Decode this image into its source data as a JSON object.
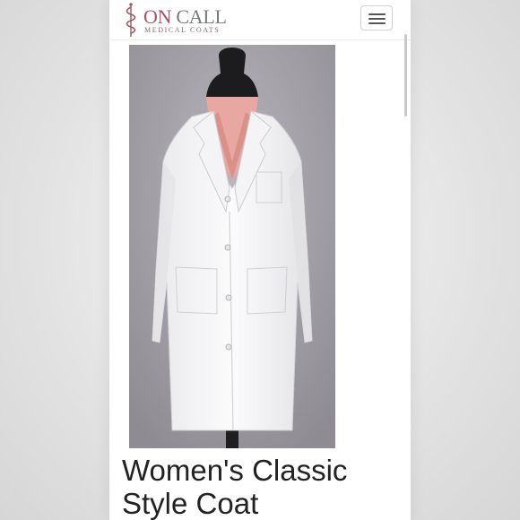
{
  "header": {
    "brand_on": "ON",
    "brand_call": "CALL",
    "tagline": "MEDICAL COATS",
    "menu_icon": "hamburger-icon"
  },
  "product": {
    "image": "white lab coat on mannequin",
    "title_line1": "Women's Classic",
    "title_line2": "Style Coat"
  },
  "colors": {
    "brand_accent": "#a8545e",
    "brand_gray": "#7a7a7a",
    "title_text": "#222222"
  }
}
